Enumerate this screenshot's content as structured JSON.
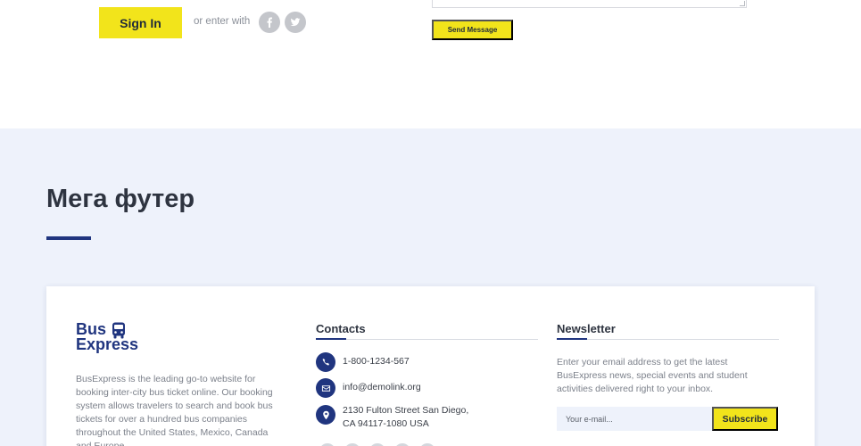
{
  "top": {
    "signin_label": "Sign In",
    "or_enter_with": "or enter with",
    "send_message_label": "Send Message"
  },
  "section": {
    "heading": "Мега футер"
  },
  "footer": {
    "logo_line1": "Bus",
    "logo_line2": "Express",
    "about": "BusExpress is the leading go-to website for booking inter-city bus ticket online. Our booking system allows travelers to search and book bus tickets for over a hundred bus companies throughout the United States, Mexico, Canada and Europe.",
    "contacts_title": "Contacts",
    "phone": "1-800-1234-567",
    "email": "info@demolink.org",
    "address_line1": "2130 Fulton Street San Diego,",
    "address_line2": "CA 94117-1080 USA",
    "newsletter_title": "Newsletter",
    "newsletter_text": "Enter your email address to get the latest BusExpress news, special events and student activities delivered right to your inbox.",
    "email_placeholder": "Your e-mail...",
    "subscribe_label": "Subscribe"
  },
  "colors": {
    "accent_yellow": "#f2e41b",
    "brand_blue": "#20357f",
    "section_bg": "#eef2fb"
  }
}
